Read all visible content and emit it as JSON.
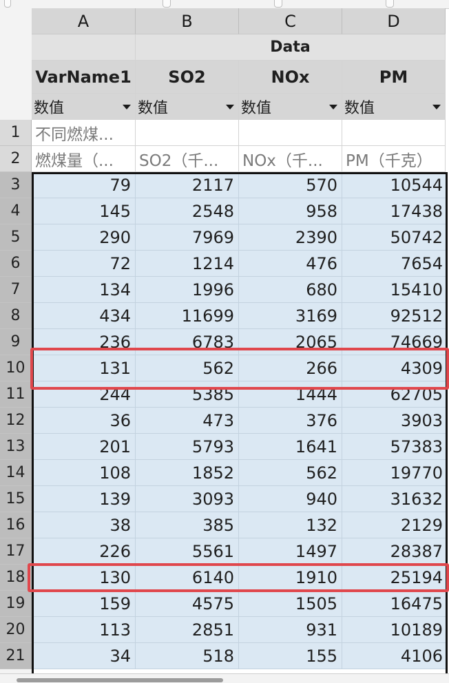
{
  "columns": [
    "A",
    "B",
    "C",
    "D"
  ],
  "group_header": "Data",
  "var_names": [
    "VarName1",
    "SO2",
    "NOx",
    "PM"
  ],
  "type_labels": [
    "数值",
    "数值",
    "数值",
    "数值"
  ],
  "text_rows": [
    {
      "row": "1",
      "cells": [
        "不同燃煤...",
        "",
        "",
        ""
      ]
    },
    {
      "row": "2",
      "cells": [
        "燃煤量（...",
        "SO2（千...",
        "NOx（千...",
        "PM（千克）"
      ]
    }
  ],
  "data_rows": [
    {
      "row": "3",
      "cells": [
        "79",
        "2117",
        "570",
        "10544"
      ]
    },
    {
      "row": "4",
      "cells": [
        "145",
        "2548",
        "958",
        "17438"
      ]
    },
    {
      "row": "5",
      "cells": [
        "290",
        "7969",
        "2390",
        "50742"
      ]
    },
    {
      "row": "6",
      "cells": [
        "72",
        "1214",
        "476",
        "7654"
      ]
    },
    {
      "row": "7",
      "cells": [
        "134",
        "1996",
        "680",
        "15410"
      ]
    },
    {
      "row": "8",
      "cells": [
        "434",
        "11699",
        "3169",
        "92512"
      ]
    },
    {
      "row": "9",
      "cells": [
        "236",
        "6783",
        "2065",
        "74669"
      ]
    },
    {
      "row": "10",
      "cells": [
        "131",
        "562",
        "266",
        "4309"
      ]
    },
    {
      "row": "11",
      "cells": [
        "244",
        "5385",
        "1444",
        "62705"
      ]
    },
    {
      "row": "12",
      "cells": [
        "36",
        "473",
        "376",
        "3903"
      ]
    },
    {
      "row": "13",
      "cells": [
        "201",
        "5793",
        "1641",
        "57383"
      ]
    },
    {
      "row": "14",
      "cells": [
        "108",
        "1852",
        "562",
        "19770"
      ]
    },
    {
      "row": "15",
      "cells": [
        "139",
        "3093",
        "940",
        "31632"
      ]
    },
    {
      "row": "16",
      "cells": [
        "38",
        "385",
        "132",
        "2129"
      ]
    },
    {
      "row": "17",
      "cells": [
        "226",
        "5561",
        "1497",
        "28387"
      ]
    },
    {
      "row": "18",
      "cells": [
        "130",
        "6140",
        "1910",
        "25194"
      ]
    },
    {
      "row": "19",
      "cells": [
        "159",
        "4575",
        "1505",
        "16475"
      ]
    },
    {
      "row": "20",
      "cells": [
        "113",
        "2851",
        "931",
        "10189"
      ]
    },
    {
      "row": "21",
      "cells": [
        "34",
        "518",
        "155",
        "4106"
      ]
    }
  ],
  "highlighted_rows": [
    "10",
    "18"
  ],
  "colors": {
    "selection_fill": "#dbe8f3",
    "highlight_border": "#e0474c",
    "header_gray": "#d6d6d6"
  }
}
